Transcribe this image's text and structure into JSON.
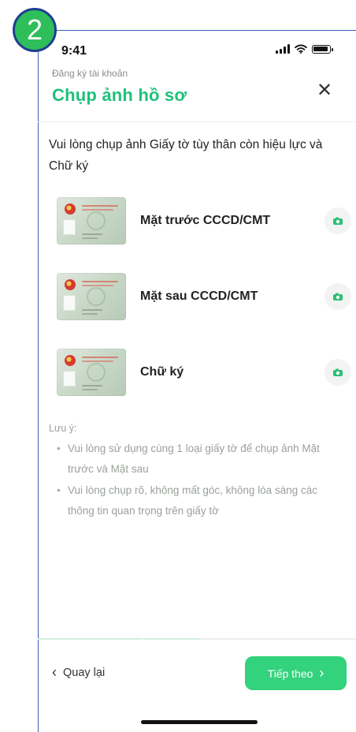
{
  "annotation": {
    "step": "2",
    "frame_color": "#3d5fb4",
    "badge_color": "#2ebf5a"
  },
  "status_bar": {
    "time": "9:41",
    "icons": [
      "signal-icon",
      "wifi-icon",
      "battery-icon"
    ]
  },
  "header": {
    "breadcrumb": "Đăng ký tài khoản",
    "title": "Chụp ảnh hồ sơ",
    "close_icon": "close-icon",
    "title_color": "#1ec17b"
  },
  "instruction": "Vui lòng chụp ảnh Giấy tờ tùy thân còn hiệu lực và Chữ ký",
  "documents": [
    {
      "label": "Mặt trước CCCD/CMT",
      "thumbnail_icon": "id-card-thumbnail",
      "action_icon": "camera-icon"
    },
    {
      "label": "Mặt sau CCCD/CMT",
      "thumbnail_icon": "id-card-thumbnail",
      "action_icon": "camera-icon"
    },
    {
      "label": "Chữ ký",
      "thumbnail_icon": "id-card-thumbnail",
      "action_icon": "camera-icon"
    }
  ],
  "note": {
    "title": "Lưu ý:",
    "items": [
      "Vui lòng sử dụng cùng 1 loại giấy tờ để chụp ảnh Mặt trước và Mặt sau",
      "Vui lòng chụp rõ, không mất góc, không lóa sáng các thông tin quan trọng trên giấy tờ"
    ],
    "text_color": "#9aa19a"
  },
  "footer": {
    "back_label": "Quay lại",
    "next_label": "Tiếp theo",
    "back_icon": "chevron-left-icon",
    "next_icon": "chevron-right-icon",
    "accent": "#33d27c"
  }
}
